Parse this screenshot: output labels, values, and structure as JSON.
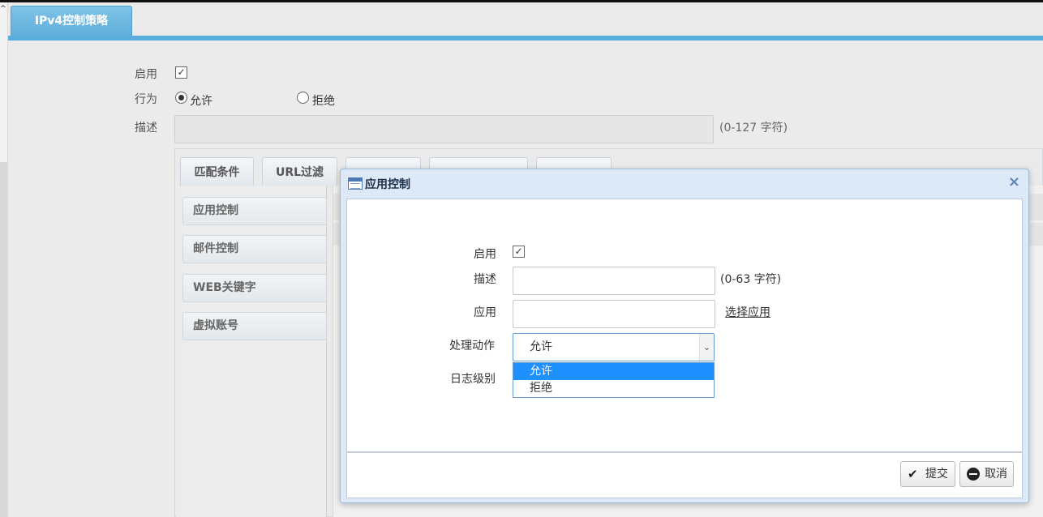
{
  "main_tab": {
    "label": "IPv4控制策略"
  },
  "policy_form": {
    "enable_label": "启用",
    "enable_checked": true,
    "action_label": "行为",
    "action_options": [
      "允许",
      "拒绝"
    ],
    "action_selected": "允许",
    "desc_label": "描述",
    "desc_value": "",
    "desc_hint": "(0-127 字符)"
  },
  "sub_tabs": [
    "匹配条件",
    "URL过滤"
  ],
  "side_menu": [
    "应用控制",
    "邮件控制",
    "WEB关键字",
    "虚拟账号"
  ],
  "dialog": {
    "title": "应用控制",
    "close_glyph": "×",
    "enable_label": "启用",
    "enable_checked": true,
    "desc_label": "描述",
    "desc_value": "",
    "desc_hint": "(0-63 字符)",
    "app_label": "应用",
    "app_value": "",
    "select_app_link": "选择应用",
    "action_label": "处理动作",
    "action_value": "允许",
    "action_options": [
      "允许",
      "拒绝"
    ],
    "log_label": "日志级别",
    "submit_label": "提交",
    "cancel_label": "取消"
  },
  "icons": {
    "checkbox": "check-mark",
    "submit": "check-icon",
    "cancel": "minus-circle-icon",
    "title": "window-icon"
  }
}
